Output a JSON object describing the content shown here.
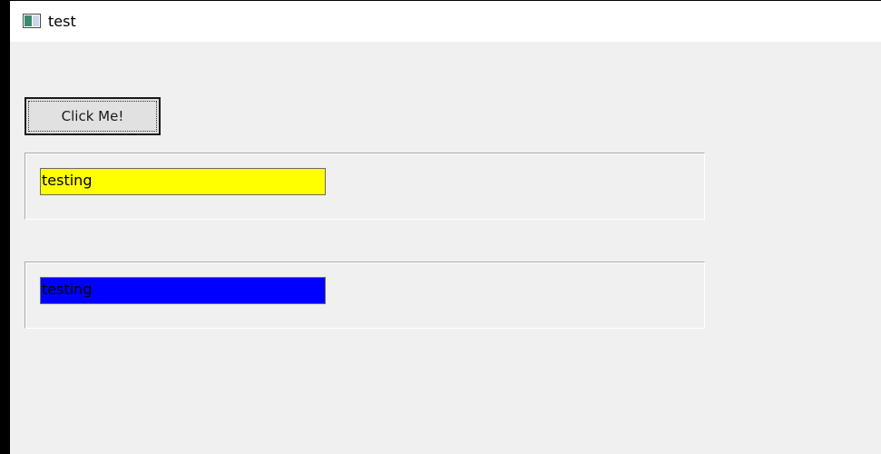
{
  "window": {
    "title": "test",
    "icon": "window-app-icon"
  },
  "main": {
    "button_label": "Click Me!",
    "fields": [
      {
        "text": "testing",
        "background": "#ffff00"
      },
      {
        "text": "testing",
        "background": "#0000ff"
      }
    ]
  },
  "colors": {
    "window_background": "#f0f0f0",
    "titlebar_background": "#ffffff",
    "desktop_background": "#000000"
  }
}
